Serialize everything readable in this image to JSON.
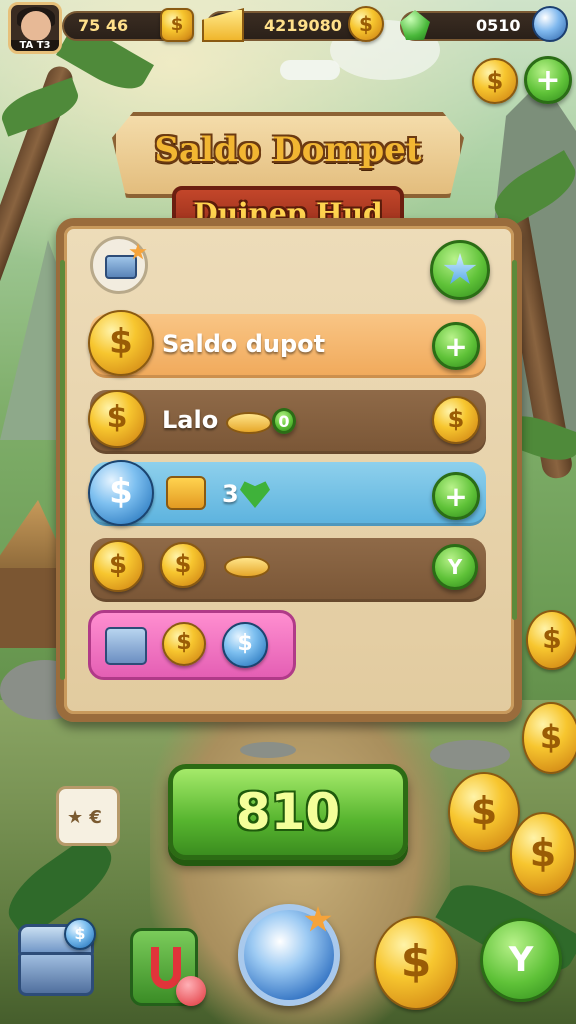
{
  "hud": {
    "avatar_tag": "TA T3",
    "stat_left": "75 46",
    "gold_amount": "4219080",
    "gem_amount": "0510"
  },
  "title": {
    "main": "Saldo Dompet",
    "sub": "Duinep Hud"
  },
  "rows": [
    {
      "label": "Saldo dupot",
      "action": "+"
    },
    {
      "label": "Lalo",
      "value": "0"
    },
    {
      "value": "3",
      "action": "+"
    },
    {
      "action": "Y"
    }
  ],
  "claim_button": "810",
  "side_buttons": {
    "add": "+"
  },
  "ticket_label": "★ €",
  "coin_symbol": "$",
  "icons": {
    "avatar": "avatar-portrait",
    "gold": "gold-coin-icon",
    "gem": "green-gem-icon",
    "orb": "blue-orb-icon",
    "chest": "chest-icon",
    "magnet": "magnet-icon",
    "star": "star-icon",
    "heart": "green-heart-icon"
  },
  "colors": {
    "accent_green": "#57b52f",
    "gold": "#f7c62f",
    "title_gold": "#f2b632",
    "panel": "#e2cb9f",
    "row_orange": "#f0a95a",
    "row_blue": "#5bb2de",
    "pink": "#e45fb4"
  }
}
